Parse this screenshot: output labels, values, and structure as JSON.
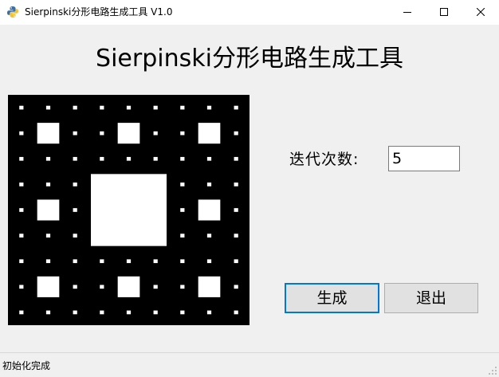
{
  "window": {
    "title": "Sierpinski分形电路生成工具 V1.0",
    "app_icon": "python-icon",
    "controls": {
      "minimize": "minimize-icon",
      "maximize": "maximize-icon",
      "close": "close-icon"
    }
  },
  "main": {
    "heading": "Sierpinski分形电路生成工具",
    "fractal_preview": {
      "type": "sierpinski-carpet",
      "levels_drawn": 3,
      "foreground": "#000000",
      "holes": "#ffffff"
    },
    "iterations": {
      "label": "迭代次数:",
      "value": "5"
    },
    "buttons": {
      "generate": "生成",
      "exit": "退出"
    }
  },
  "status": {
    "text": "初始化完成"
  },
  "colors": {
    "focus_border": "#0078d7",
    "window_bg": "#f0f0f0",
    "button_bg": "#e1e1e1"
  }
}
